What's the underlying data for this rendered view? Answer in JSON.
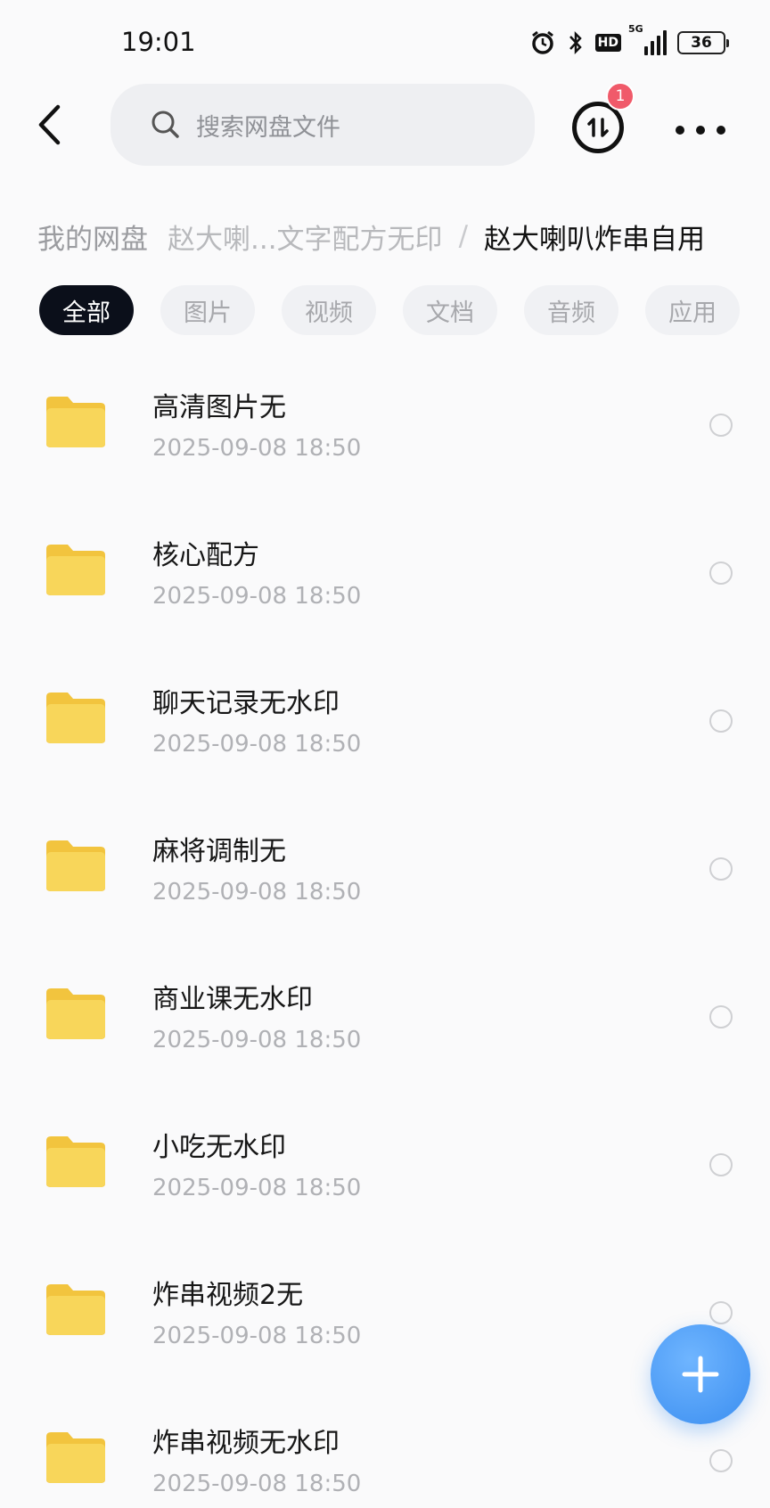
{
  "status_bar": {
    "time": "19:01",
    "network": "5G",
    "hd": "HD",
    "battery": "36"
  },
  "top_bar": {
    "search_placeholder": "搜索网盘文件",
    "transfer_badge": "1"
  },
  "breadcrumb": {
    "root": "我的网盘",
    "middle": "赵大喇...文字配方无印",
    "separator": "/",
    "current": "赵大喇叭炸串自用"
  },
  "filter_tabs": [
    {
      "label": "全部",
      "active": true
    },
    {
      "label": "图片",
      "active": false
    },
    {
      "label": "视频",
      "active": false
    },
    {
      "label": "文档",
      "active": false
    },
    {
      "label": "音频",
      "active": false
    },
    {
      "label": "应用",
      "active": false
    }
  ],
  "files": [
    {
      "name": "高清图片无",
      "date": "2025-09-08  18:50"
    },
    {
      "name": "核心配方",
      "date": "2025-09-08  18:50"
    },
    {
      "name": "聊天记录无水印",
      "date": "2025-09-08  18:50"
    },
    {
      "name": "麻将调制无",
      "date": "2025-09-08  18:50"
    },
    {
      "name": "商业课无水印",
      "date": "2025-09-08  18:50"
    },
    {
      "name": "小吃无水印",
      "date": "2025-09-08  18:50"
    },
    {
      "name": "炸串视频2无",
      "date": "2025-09-08  18:50"
    },
    {
      "name": "炸串视频无水印",
      "date": "2025-09-08  18:50"
    }
  ],
  "colors": {
    "folder": "#f6cf4d",
    "accent": "#3b8ef0",
    "active_tab": "#0b0f1a"
  }
}
